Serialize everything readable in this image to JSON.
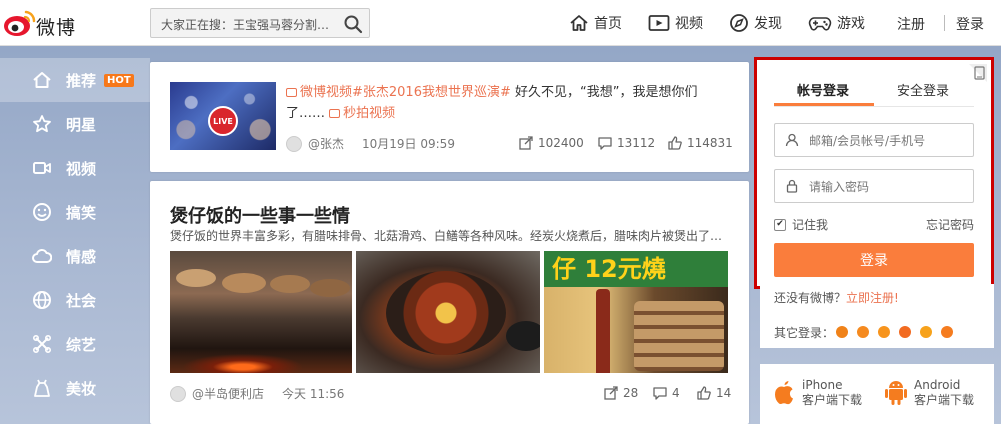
{
  "brand": {
    "name": "微博",
    "accent": "#fa7d3c"
  },
  "header": {
    "search_placeholder": "大家正在搜：王宝强马蓉分割…",
    "nav": [
      {
        "label": "首页",
        "icon": "home-icon"
      },
      {
        "label": "视频",
        "icon": "video-icon"
      },
      {
        "label": "发现",
        "icon": "compass-icon"
      },
      {
        "label": "游戏",
        "icon": "gamepad-icon"
      }
    ],
    "register": "注册",
    "login": "登录"
  },
  "sidebar": {
    "items": [
      {
        "label": "推荐",
        "icon": "home-icon",
        "badge": "HOT",
        "active": true
      },
      {
        "label": "明星",
        "icon": "star-icon"
      },
      {
        "label": "视频",
        "icon": "video-icon"
      },
      {
        "label": "搞笑",
        "icon": "smile-icon"
      },
      {
        "label": "情感",
        "icon": "cloud-icon"
      },
      {
        "label": "社会",
        "icon": "globe-icon"
      },
      {
        "label": "综艺",
        "icon": "knot-icon"
      },
      {
        "label": "美妆",
        "icon": "dress-icon"
      }
    ]
  },
  "feed": {
    "post1": {
      "topic": "微博视频#张杰2016我想世界巡演#",
      "text": " 好久不见，“我想”，我是想你们了……",
      "tag": "秒拍视频",
      "author": "@张杰",
      "time": "10月19日 09:59",
      "thumb_badge": "LIVE",
      "shares": "102400",
      "comments": "13112",
      "likes": "114831"
    },
    "post2": {
      "title": "煲仔饭的一些事一些情",
      "desc": "煲仔饭的世界丰富多彩，有腊味排骨、北菇滑鸡、白鳝等各种风味。经炭火烧煮后，腊味肉片被煲出了…",
      "sign_text": "仔 12元燒",
      "author": "@半岛便利店",
      "time": "今天 11:56",
      "shares": "28",
      "comments": "4",
      "likes": "14"
    }
  },
  "login": {
    "tab_account": "帐号登录",
    "tab_secure": "安全登录",
    "username_placeholder": "邮箱/会员帐号/手机号",
    "password_placeholder": "请输入密码",
    "remember": "记住我",
    "forgot": "忘记密码",
    "submit": "登录",
    "no_account": "还没有微博？",
    "register_now": "立即注册!",
    "other_login": "其它登录："
  },
  "apps": {
    "iphone": {
      "name": "iPhone",
      "sub": "客户端下载"
    },
    "android": {
      "name": "Android",
      "sub": "客户端下载"
    }
  }
}
